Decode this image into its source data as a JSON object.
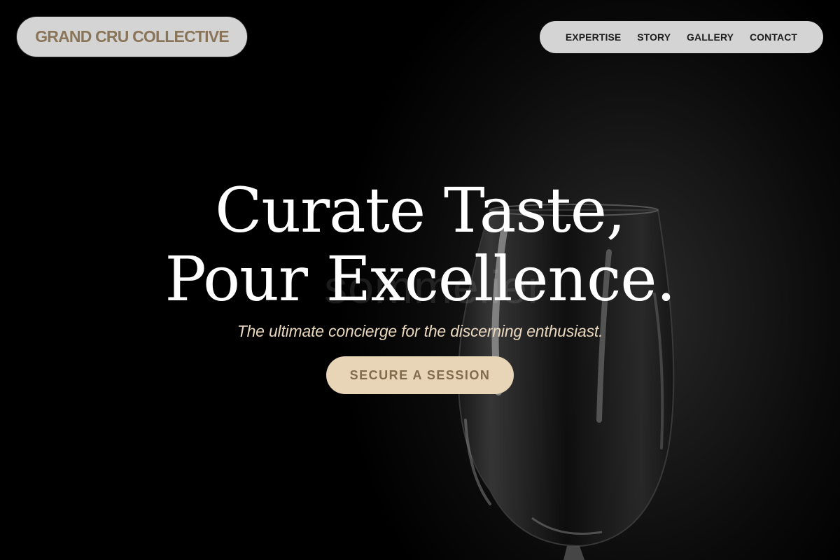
{
  "brand": {
    "name": "GRAND CRU COLLECTIVE",
    "accent_color": "#8a7559"
  },
  "nav": {
    "items": [
      {
        "label": "EXPERTISE"
      },
      {
        "label": "STORY"
      },
      {
        "label": "GALLERY"
      },
      {
        "label": "CONTACT"
      }
    ]
  },
  "hero": {
    "title_line1": "Curate Taste,",
    "title_line2": "Pour Excellence.",
    "subtitle": "The ultimate concierge for the discerning enthusiast.",
    "cta_label": "SECURE A SESSION",
    "cta_color": "#e8d4b6",
    "background_image": "wine-glass-on-black",
    "ghost_text": "sommelier"
  }
}
